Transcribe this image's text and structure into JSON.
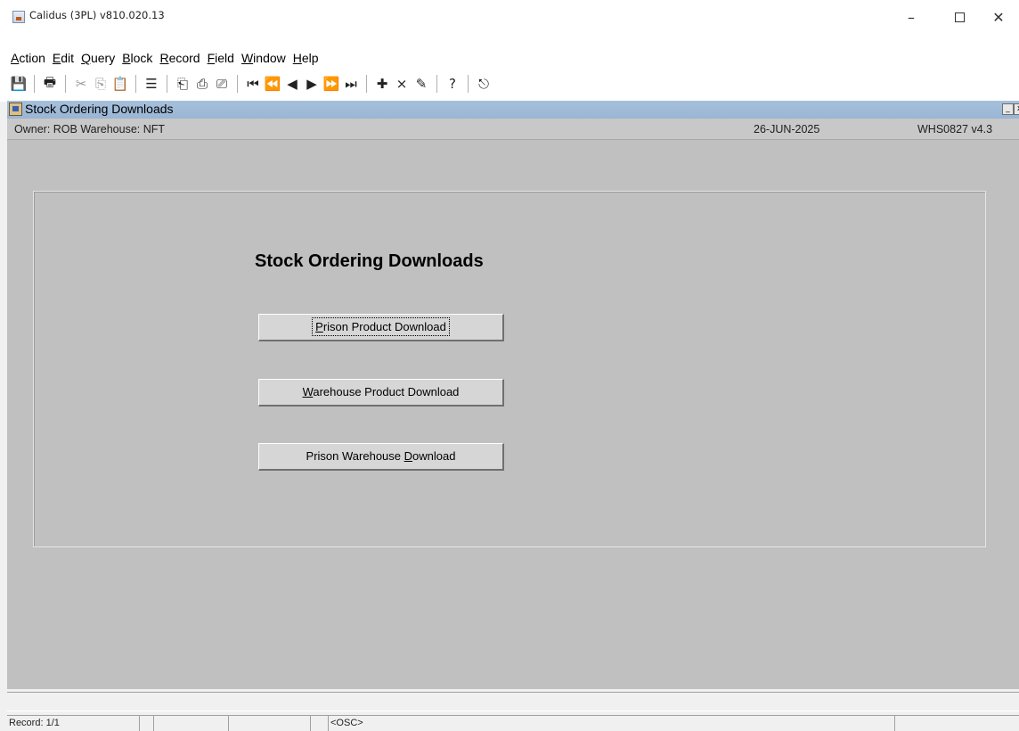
{
  "app": {
    "title": "Calidus (3PL) v810.020.13",
    "window_controls": {
      "minimize": "–",
      "close": "✕"
    }
  },
  "menu": {
    "items": [
      {
        "label_pre": "",
        "label_ul": "A",
        "label_post": "ction"
      },
      {
        "label_pre": "",
        "label_ul": "E",
        "label_post": "dit"
      },
      {
        "label_pre": "",
        "label_ul": "Q",
        "label_post": "uery"
      },
      {
        "label_pre": "",
        "label_ul": "B",
        "label_post": "lock"
      },
      {
        "label_pre": "",
        "label_ul": "R",
        "label_post": "ecord"
      },
      {
        "label_pre": "",
        "label_ul": "F",
        "label_post": "ield"
      },
      {
        "label_pre": "",
        "label_ul": "W",
        "label_post": "indow"
      },
      {
        "label_pre": "",
        "label_ul": "H",
        "label_post": "elp"
      }
    ]
  },
  "toolbar": {
    "icons": {
      "save": "💾",
      "print": "🖶",
      "cut": "✂",
      "copy": "⎘",
      "paste": "📋",
      "list": "☰",
      "query": "⎗",
      "execute": "⎙",
      "cancel": "⎚",
      "first": "⏮",
      "prev_set": "⏪",
      "prev": "◀",
      "next": "▶",
      "next_set": "⏩",
      "last": "⏭",
      "insert": "✚",
      "delete": "⨯",
      "clear": "✎",
      "help": "?",
      "exit": "⎋"
    }
  },
  "window": {
    "title": "Stock Ordering Downloads",
    "min": "_",
    "close": "x"
  },
  "info": {
    "owner_warehouse": "Owner:  ROB    Warehouse:  NFT",
    "date": "26-JUN-2025",
    "form": "WHS0827  v4.3"
  },
  "form": {
    "heading": "Stock Ordering Downloads",
    "buttons": [
      {
        "pre": "",
        "ul": "P",
        "post": "rison Product Download"
      },
      {
        "pre": "",
        "ul": "W",
        "post": "arehouse Product Download"
      },
      {
        "pre": "Prison Warehouse ",
        "ul": "D",
        "post": "ownload"
      }
    ]
  },
  "status": {
    "record": "Record: 1/1",
    "cell2": "",
    "cell3": "",
    "cell4": "",
    "cell5": "",
    "mode": "<OSC>",
    "cell7": ""
  },
  "colors": {
    "window_title_bg": "#9ab6d4",
    "canvas_bg": "#c0c0c0",
    "button_bg": "#d6d6d6"
  }
}
